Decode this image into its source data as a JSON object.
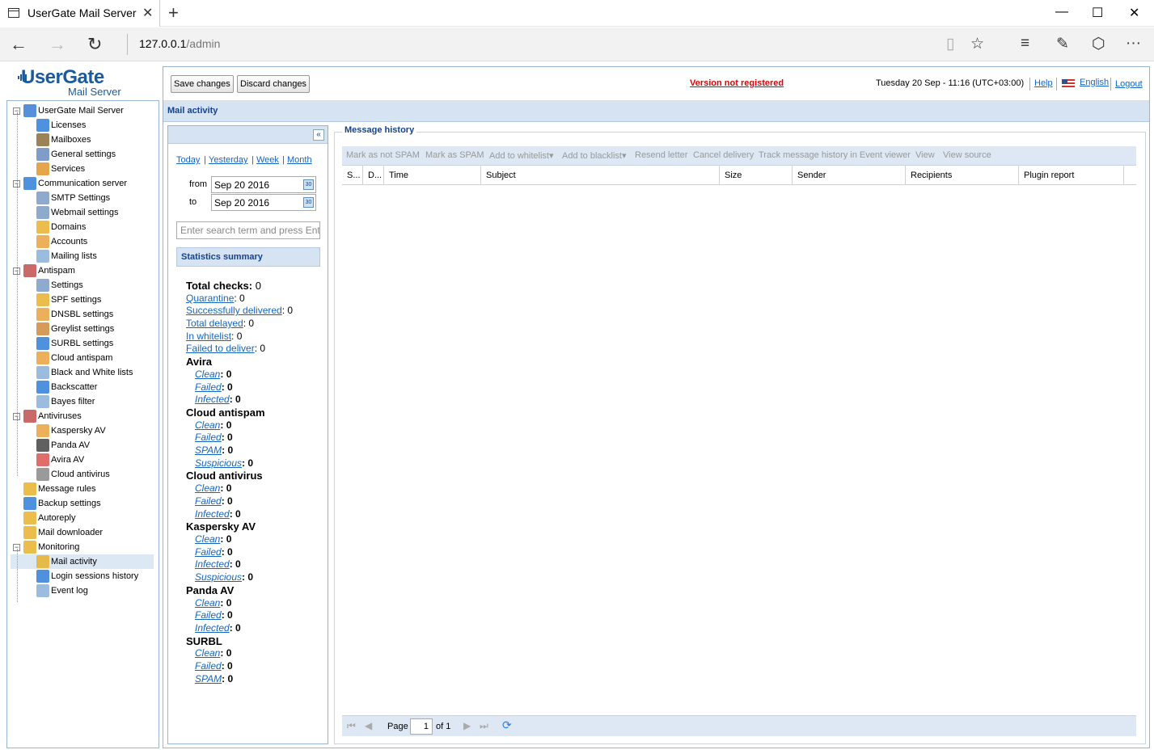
{
  "browser": {
    "tab_title": "UserGate Mail Server",
    "url_host": "127.0.0.1",
    "url_path": "/admin"
  },
  "logo": {
    "line1": "UserGate",
    "line2": "Mail Server"
  },
  "tree": [
    {
      "label": "UserGate Mail Server",
      "level": 0,
      "expander": "minus",
      "color": "#3a7bd5"
    },
    {
      "label": "Licenses",
      "level": 1,
      "color": "#2f7ed8"
    },
    {
      "label": "Mailboxes",
      "level": 1,
      "color": "#8a6d3b"
    },
    {
      "label": "General settings",
      "level": 1,
      "color": "#6a8bbf"
    },
    {
      "label": "Services",
      "level": 1,
      "color": "#e0952b"
    },
    {
      "label": "Communication server",
      "level": 0,
      "expander": "minus",
      "color": "#2f7ed8"
    },
    {
      "label": "SMTP Settings",
      "level": 1,
      "color": "#7a9cc6"
    },
    {
      "label": "Webmail settings",
      "level": 1,
      "color": "#7a9cc6"
    },
    {
      "label": "Domains",
      "level": 1,
      "color": "#e8b12c"
    },
    {
      "label": "Accounts",
      "level": 1,
      "color": "#e8a23c"
    },
    {
      "label": "Mailing lists",
      "level": 1,
      "color": "#8ab0d8"
    },
    {
      "label": "Antispam",
      "level": 0,
      "expander": "minus",
      "color": "#c0504d"
    },
    {
      "label": "Settings",
      "level": 1,
      "color": "#7a9cc6"
    },
    {
      "label": "SPF settings",
      "level": 1,
      "color": "#e8b12c"
    },
    {
      "label": "DNSBL settings",
      "level": 1,
      "color": "#e8a23c"
    },
    {
      "label": "Greylist settings",
      "level": 1,
      "color": "#d08a3c"
    },
    {
      "label": "SURBL settings",
      "level": 1,
      "color": "#2f7ed8"
    },
    {
      "label": "Cloud antispam",
      "level": 1,
      "color": "#e8a23c"
    },
    {
      "label": "Black and White lists",
      "level": 1,
      "color": "#8ab0d8"
    },
    {
      "label": "Backscatter",
      "level": 1,
      "color": "#2f7ed8"
    },
    {
      "label": "Bayes filter",
      "level": 1,
      "color": "#8ab0d8"
    },
    {
      "label": "Antiviruses",
      "level": 0,
      "expander": "minus",
      "color": "#c0504d"
    },
    {
      "label": "Kaspersky AV",
      "level": 1,
      "color": "#e8a23c"
    },
    {
      "label": "Panda AV",
      "level": 1,
      "color": "#444444"
    },
    {
      "label": "Avira AV",
      "level": 1,
      "color": "#d9534f"
    },
    {
      "label": "Cloud antivirus",
      "level": 1,
      "color": "#888888"
    },
    {
      "label": "Message rules",
      "level": 0,
      "color": "#e8b12c"
    },
    {
      "label": "Backup settings",
      "level": 0,
      "color": "#2f7ed8"
    },
    {
      "label": "Autoreply",
      "level": 0,
      "color": "#e8b12c"
    },
    {
      "label": "Mail downloader",
      "level": 0,
      "color": "#e8b12c"
    },
    {
      "label": "Monitoring",
      "level": 0,
      "expander": "minus",
      "color": "#e8b12c"
    },
    {
      "label": "Mail activity",
      "level": 1,
      "color": "#e8b12c",
      "selected": true
    },
    {
      "label": "Login sessions history",
      "level": 1,
      "color": "#2f7ed8"
    },
    {
      "label": "Event log",
      "level": 1,
      "color": "#8ab0d8"
    }
  ],
  "topbar": {
    "save_label": "Save changes",
    "discard_label": "Discard changes",
    "not_registered": "Version not registered",
    "datetime": "Tuesday 20 Sep - 11:16 (UTC+03:00)",
    "help": "Help",
    "language": "English",
    "logout": "Logout"
  },
  "section_title": "Mail activity",
  "filter": {
    "periods": [
      "Today",
      "Yesterday",
      "Week",
      "Month"
    ],
    "from_label": "from",
    "to_label": "to",
    "from_value": "Sep 20 2016",
    "to_value": "Sep 20 2016",
    "search_placeholder": "Enter search term and press Enter"
  },
  "stats": {
    "title": "Statistics summary",
    "total_checks_label": "Total checks:",
    "total_checks": "0",
    "general": [
      {
        "label": "Quarantine",
        "value": "0"
      },
      {
        "label": "Successfully delivered",
        "value": "0"
      },
      {
        "label": "Total delayed",
        "value": "0"
      },
      {
        "label": "In whitelist",
        "value": "0"
      },
      {
        "label": "Failed to deliver",
        "value": "0"
      }
    ],
    "groups": [
      {
        "name": "Avira",
        "items": [
          {
            "label": "Clean",
            "value": "0"
          },
          {
            "label": "Failed",
            "value": "0"
          },
          {
            "label": "Infected",
            "value": "0"
          }
        ]
      },
      {
        "name": "Cloud antispam",
        "items": [
          {
            "label": "Clean",
            "value": "0"
          },
          {
            "label": "Failed",
            "value": "0"
          },
          {
            "label": "SPAM",
            "value": "0"
          },
          {
            "label": "Suspicious",
            "value": "0"
          }
        ]
      },
      {
        "name": "Cloud antivirus",
        "items": [
          {
            "label": "Clean",
            "value": "0"
          },
          {
            "label": "Failed",
            "value": "0"
          },
          {
            "label": "Infected",
            "value": "0"
          }
        ]
      },
      {
        "name": "Kaspersky AV",
        "items": [
          {
            "label": "Clean",
            "value": "0"
          },
          {
            "label": "Failed",
            "value": "0"
          },
          {
            "label": "Infected",
            "value": "0"
          },
          {
            "label": "Suspicious",
            "value": "0"
          }
        ]
      },
      {
        "name": "Panda AV",
        "items": [
          {
            "label": "Clean",
            "value": "0"
          },
          {
            "label": "Failed",
            "value": "0"
          },
          {
            "label": "Infected",
            "value": "0"
          }
        ]
      },
      {
        "name": "SURBL",
        "items": [
          {
            "label": "Clean",
            "value": "0"
          },
          {
            "label": "Failed",
            "value": "0"
          },
          {
            "label": "SPAM",
            "value": "0"
          }
        ]
      }
    ]
  },
  "history": {
    "title": "Message history",
    "toolbar": [
      "Mark as not SPAM",
      "Mark as SPAM",
      "Add to whitelist",
      "Add to blacklist",
      "Resend letter",
      "Cancel delivery",
      "Track message history in Event viewer",
      "View",
      "View source"
    ],
    "columns": [
      "S...",
      "D...",
      "Time",
      "Subject",
      "Size",
      "Sender",
      "Recipients",
      "Plugin report"
    ],
    "pager": {
      "page_label": "Page",
      "page_value": "1",
      "of_label": "of 1"
    }
  }
}
